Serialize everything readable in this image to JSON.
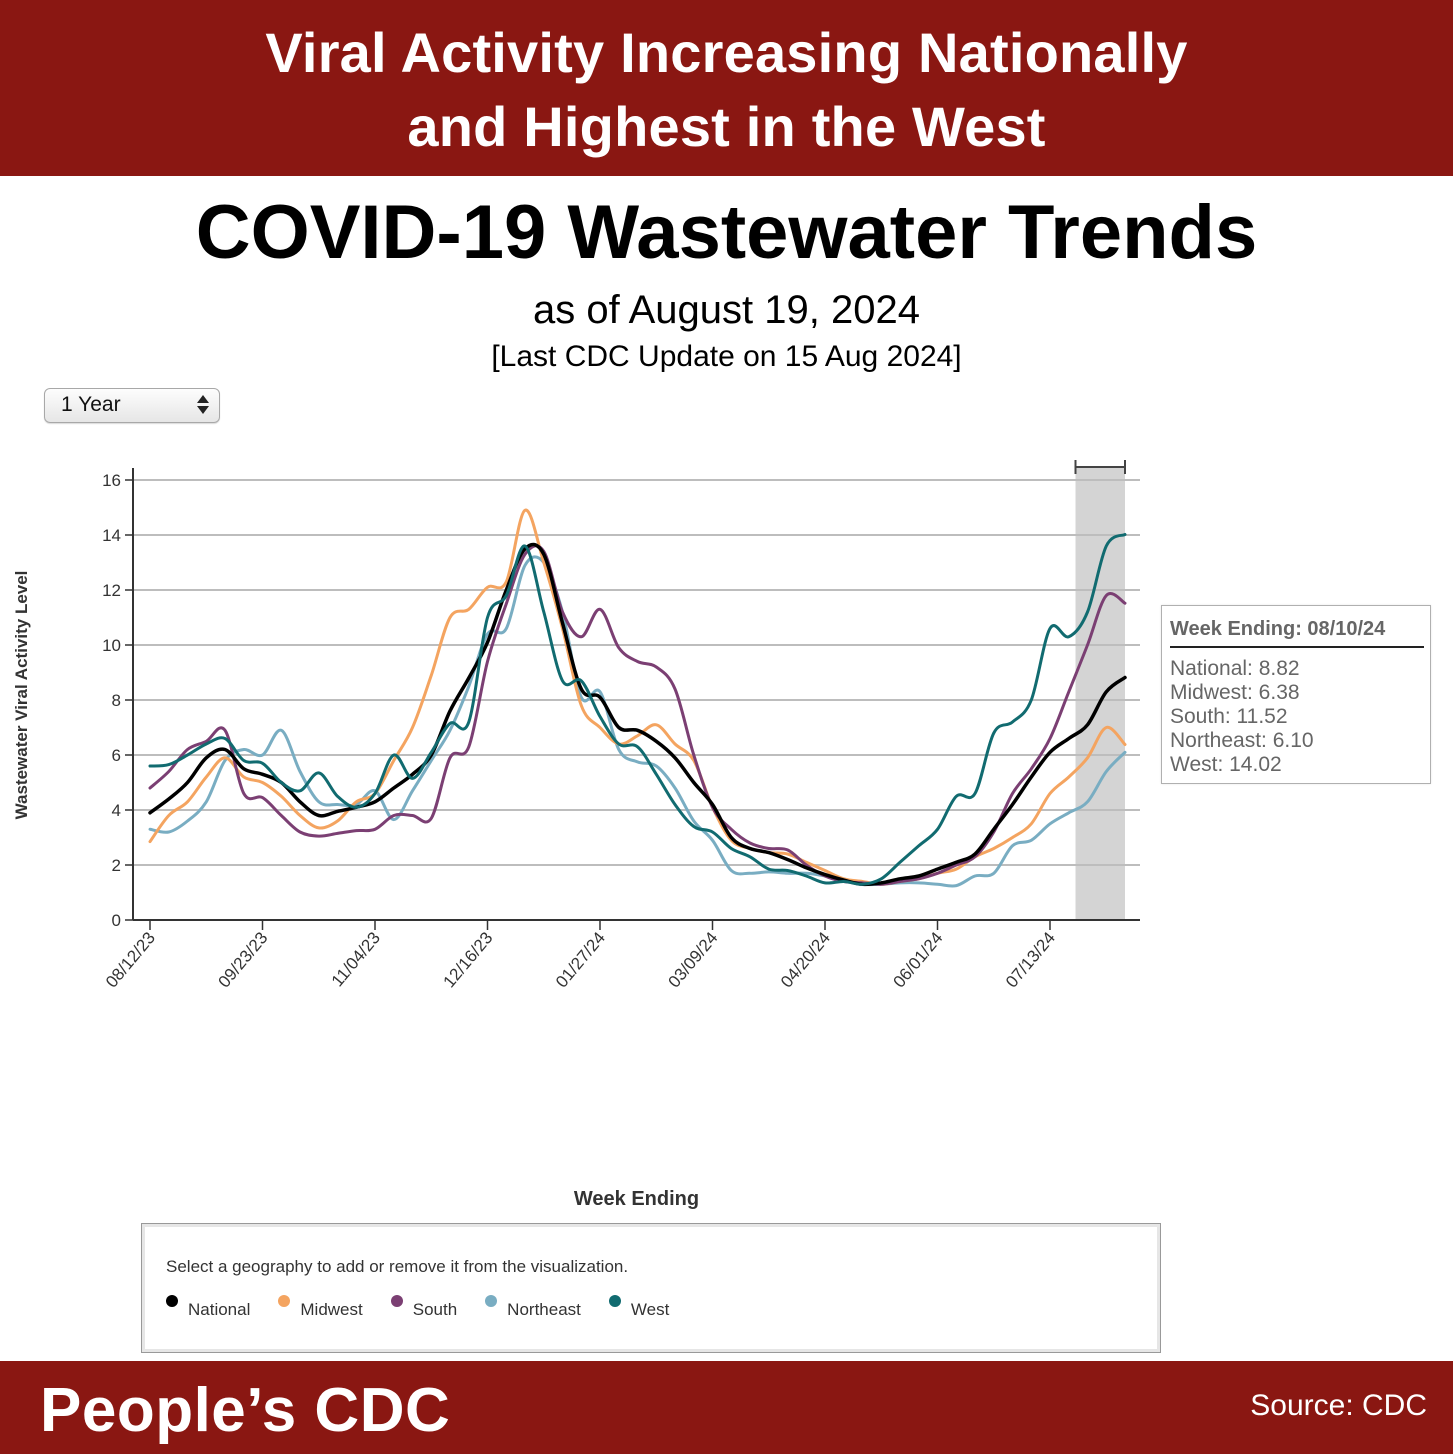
{
  "header": {
    "banner_line1": "Viral Activity Increasing Nationally",
    "banner_line2": "and Highest in the West",
    "title": "COVID-19 Wastewater Trends",
    "subtitle": "as of August 19, 2024",
    "update_note": "[Last CDC Update on 15 Aug 2024]"
  },
  "controls": {
    "time_range_selected": "1 Year"
  },
  "tooltip": {
    "title": "Week Ending: 08/10/24",
    "rows": [
      "National: 8.82",
      "Midwest: 6.38",
      "South: 11.52",
      "Northeast: 6.10",
      "West: 14.02"
    ]
  },
  "legend": {
    "hint": "Select a geography to add or remove it from the visualization.",
    "items": [
      {
        "label": "National",
        "color": "#000000"
      },
      {
        "label": "Midwest",
        "color": "#f4a460"
      },
      {
        "label": "South",
        "color": "#7b3f73"
      },
      {
        "label": "Northeast",
        "color": "#79adc2"
      },
      {
        "label": "West",
        "color": "#116b70"
      }
    ]
  },
  "footer": {
    "brand": "People’s CDC",
    "source": "Source: CDC"
  },
  "colors": {
    "banner": "#8a1712",
    "highlight_band": "#d4d4d4",
    "grid": "#bdbdbd"
  },
  "chart_data": {
    "type": "line",
    "title": "COVID-19 Wastewater Trends",
    "xlabel": "Week Ending",
    "ylabel": "Wastewater Viral Activity Level",
    "ylim": [
      0,
      16
    ],
    "yticks": [
      0,
      2,
      4,
      6,
      8,
      10,
      12,
      14,
      16
    ],
    "xtick_labels": [
      "08/12/23",
      "09/23/23",
      "11/04/23",
      "12/16/23",
      "01/27/24",
      "03/09/24",
      "04/20/24",
      "06/01/24",
      "07/13/24"
    ],
    "xtick_week_index": [
      0,
      6,
      12,
      18,
      24,
      30,
      36,
      42,
      48
    ],
    "x_start": "08/12/23",
    "x_end": "08/10/24",
    "n_weeks": 53,
    "grid": true,
    "highlight": {
      "label": "Week Ending: 08/10/24",
      "from_week_index": 50,
      "to_week_index": 52
    },
    "legend_position": "bottom",
    "series": [
      {
        "name": "National",
        "color": "#000000",
        "values": [
          3.9,
          4.4,
          5.0,
          5.9,
          6.2,
          5.5,
          5.3,
          5.0,
          4.3,
          3.8,
          3.95,
          4.1,
          4.3,
          4.8,
          5.3,
          6.0,
          7.6,
          8.8,
          10.1,
          12.0,
          13.5,
          13.3,
          10.8,
          8.4,
          8.1,
          7.0,
          6.9,
          6.5,
          5.9,
          5.0,
          4.2,
          3.0,
          2.6,
          2.45,
          2.2,
          1.9,
          1.65,
          1.45,
          1.3,
          1.35,
          1.5,
          1.6,
          1.85,
          2.1,
          2.4,
          3.3,
          4.2,
          5.2,
          6.1,
          6.6,
          7.1,
          8.3,
          8.82
        ]
      },
      {
        "name": "Midwest",
        "color": "#f4a460",
        "values": [
          2.85,
          3.8,
          4.3,
          5.2,
          5.9,
          5.2,
          5.0,
          4.5,
          3.8,
          3.35,
          3.6,
          4.3,
          4.6,
          5.8,
          7.0,
          8.9,
          11.0,
          11.3,
          12.1,
          12.3,
          14.9,
          13.0,
          10.6,
          7.8,
          7.0,
          6.4,
          6.7,
          7.1,
          6.4,
          5.8,
          4.1,
          2.9,
          2.6,
          2.45,
          2.4,
          2.1,
          1.8,
          1.5,
          1.4,
          1.3,
          1.4,
          1.5,
          1.7,
          1.85,
          2.3,
          2.6,
          3.0,
          3.5,
          4.6,
          5.2,
          5.9,
          7.0,
          6.38
        ]
      },
      {
        "name": "South",
        "color": "#7b3f73",
        "values": [
          4.8,
          5.4,
          6.2,
          6.5,
          6.9,
          4.6,
          4.45,
          3.8,
          3.2,
          3.05,
          3.15,
          3.25,
          3.3,
          3.8,
          3.8,
          3.7,
          5.9,
          6.3,
          9.4,
          11.5,
          13.3,
          13.4,
          11.2,
          10.3,
          11.3,
          9.9,
          9.4,
          9.2,
          8.4,
          6.0,
          4.1,
          3.3,
          2.8,
          2.6,
          2.55,
          2.0,
          1.6,
          1.4,
          1.35,
          1.3,
          1.4,
          1.5,
          1.7,
          2.0,
          2.3,
          3.2,
          4.6,
          5.5,
          6.6,
          8.3,
          10.0,
          11.8,
          11.52
        ]
      },
      {
        "name": "Northeast",
        "color": "#79adc2",
        "values": [
          3.3,
          3.2,
          3.6,
          4.3,
          5.8,
          6.2,
          6.0,
          6.9,
          5.4,
          4.3,
          4.2,
          4.2,
          4.7,
          3.65,
          4.7,
          5.8,
          6.9,
          8.5,
          10.4,
          10.6,
          12.9,
          13.0,
          11.2,
          8.1,
          8.3,
          6.2,
          5.75,
          5.6,
          4.8,
          3.6,
          2.9,
          1.8,
          1.7,
          1.75,
          1.7,
          1.7,
          1.6,
          1.45,
          1.3,
          1.3,
          1.35,
          1.35,
          1.3,
          1.25,
          1.6,
          1.7,
          2.7,
          2.9,
          3.5,
          3.9,
          4.3,
          5.4,
          6.1
        ]
      },
      {
        "name": "West",
        "color": "#116b70",
        "values": [
          5.6,
          5.65,
          6.0,
          6.4,
          6.6,
          5.8,
          5.7,
          5.0,
          4.7,
          5.35,
          4.5,
          4.1,
          4.6,
          6.0,
          5.15,
          6.1,
          7.15,
          7.2,
          11.0,
          11.8,
          13.6,
          11.2,
          8.7,
          8.7,
          7.4,
          6.4,
          6.3,
          5.3,
          4.2,
          3.4,
          3.2,
          2.6,
          2.3,
          1.85,
          1.8,
          1.6,
          1.35,
          1.4,
          1.3,
          1.5,
          2.1,
          2.7,
          3.3,
          4.5,
          4.6,
          6.8,
          7.2,
          8.0,
          10.6,
          10.3,
          11.2,
          13.6,
          14.02
        ]
      }
    ]
  }
}
